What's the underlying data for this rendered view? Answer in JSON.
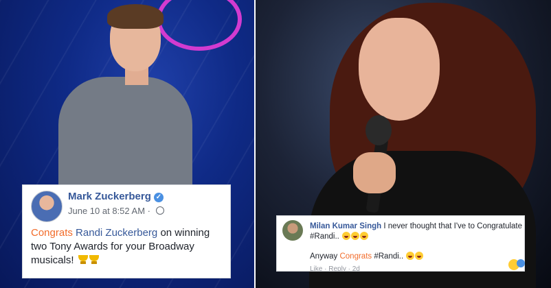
{
  "post": {
    "author": "Mark Zuckerberg",
    "timestamp": "June 10 at 8:52 AM",
    "separator": "·",
    "text": {
      "congrats": "Congrats",
      "mention": "Randi Zuckerberg",
      "rest": "on winning two Tony Awards for your Broadway musicals!"
    },
    "icons": [
      "verified-badge-icon",
      "globe-icon",
      "trophy-icon",
      "trophy-icon"
    ],
    "colors": {
      "accent": "#f26b29",
      "link": "#365899"
    }
  },
  "comment": {
    "author": "Milan Kumar Singh",
    "text": "I never thought that I've to Congratulate #Randi..",
    "reply_prefix": "Anyway",
    "reply_congrats": "Congrats",
    "reply_tag": "#Randi..",
    "footer": {
      "like": "Like",
      "dot": "·",
      "reply": "Reply",
      "time": "2d"
    }
  }
}
